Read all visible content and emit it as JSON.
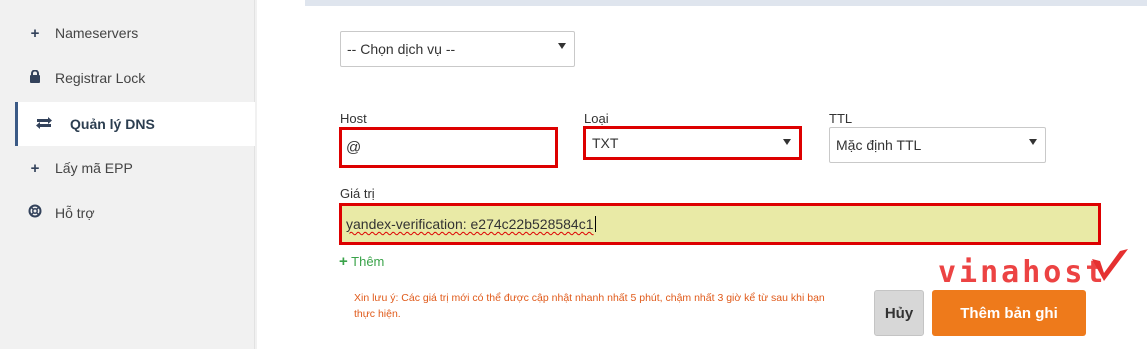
{
  "sidebar": {
    "items": [
      {
        "label": "Nameservers",
        "icon": "plus-icon"
      },
      {
        "label": "Registrar Lock",
        "icon": "lock-icon"
      },
      {
        "label": "Quản lý DNS",
        "icon": "refresh-icon",
        "active": true
      },
      {
        "label": "Lấy mã EPP",
        "icon": "plus-icon"
      },
      {
        "label": "Hỗ trợ",
        "icon": "lifebuoy-icon"
      }
    ]
  },
  "form": {
    "service_select": "-- Chọn dịch vụ --",
    "host_label": "Host",
    "host_value": "@",
    "type_label": "Loại",
    "type_value": "TXT",
    "ttl_label": "TTL",
    "ttl_value": "Mặc định TTL",
    "value_label": "Giá trị",
    "value_value": "yandex-verification: e274c22b528584c1",
    "add_link": "Thêm",
    "note": "Xin lưu ý: Các giá trị mới có thể được cập nhật nhanh nhất 5 phút, chậm nhất 3 giờ kể từ sau khi bạn thực hiện.",
    "cancel_button": "Hủy",
    "submit_button": "Thêm bản ghi"
  },
  "watermark": "vinahost",
  "colors": {
    "accent": "#ee7a1b",
    "highlight": "#d00000",
    "link": "#3aa34a"
  }
}
